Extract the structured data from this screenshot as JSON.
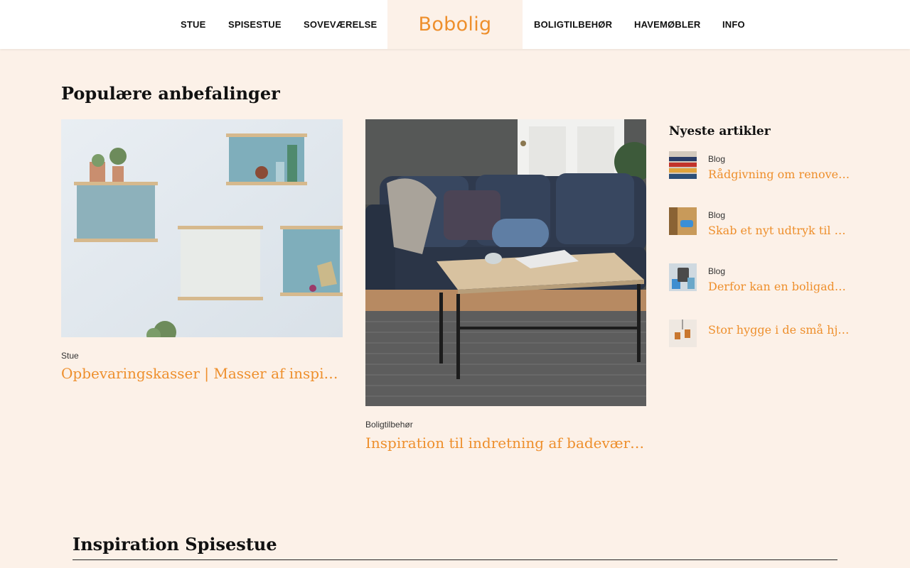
{
  "nav": {
    "left": [
      "STUE",
      "SPISESTUE",
      "SOVEVÆRELSE"
    ],
    "right": [
      "BOLIGTILBEHØR",
      "HAVEMØBLER",
      "INFO"
    ],
    "logo": "Bobolig"
  },
  "popular": {
    "heading": "Populære anbefalinger",
    "cards": [
      {
        "category": "Stue",
        "title": "Opbevaringskasser | Masser af inspiration"
      },
      {
        "category": "Boligtilbehør",
        "title": "Inspiration til indretning af badeværelse."
      }
    ]
  },
  "latest": {
    "heading": "Nyeste artikler",
    "items": [
      {
        "category": "Blog",
        "title": "Rådgivning om renovering"
      },
      {
        "category": "Blog",
        "title": "Skab et nyt udtryk til dit hjem"
      },
      {
        "category": "Blog",
        "title": "Derfor kan en boligadvokat"
      },
      {
        "category": "",
        "title": "Stor hygge i de små hjem"
      }
    ]
  },
  "section2": {
    "heading": "Inspiration Spisestue"
  },
  "colors": {
    "accent": "#ee8f2c",
    "background": "#fcf1e8",
    "header": "#ffffff"
  }
}
